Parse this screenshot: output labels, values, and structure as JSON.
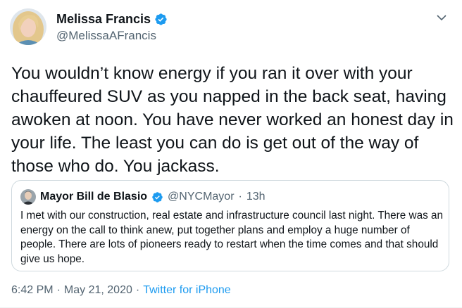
{
  "author": {
    "name": "Melissa Francis",
    "handle": "@MelissaAFrancis",
    "avatar_icon": "avatar-photo",
    "verified_icon": "verified-badge-icon"
  },
  "tweet": {
    "text": "You wouldn’t know energy if you ran it over with your chauffeured SUV as you napped in the back seat, having awoken at noon. You have never worked an honest day in your life. The least you can do is get out of the way of those who do. You jackass."
  },
  "quote": {
    "name": "Mayor Bill de Blasio",
    "handle": "@NYCMayor",
    "separator": "·",
    "time": "13h",
    "text": "I met with our construction, real estate and infrastructure council last night. There was an energy on the call to think anew, put together plans and employ a huge number of people. There are lots of pioneers ready to restart when the time comes and that should give us hope."
  },
  "meta": {
    "time": "6:42 PM",
    "sep1": "·",
    "date": "May 21, 2020",
    "sep2": "·",
    "source": "Twitter for iPhone"
  },
  "colors": {
    "accent": "#1d9bf0",
    "secondary_text": "#536471",
    "border": "#cfd9de"
  }
}
